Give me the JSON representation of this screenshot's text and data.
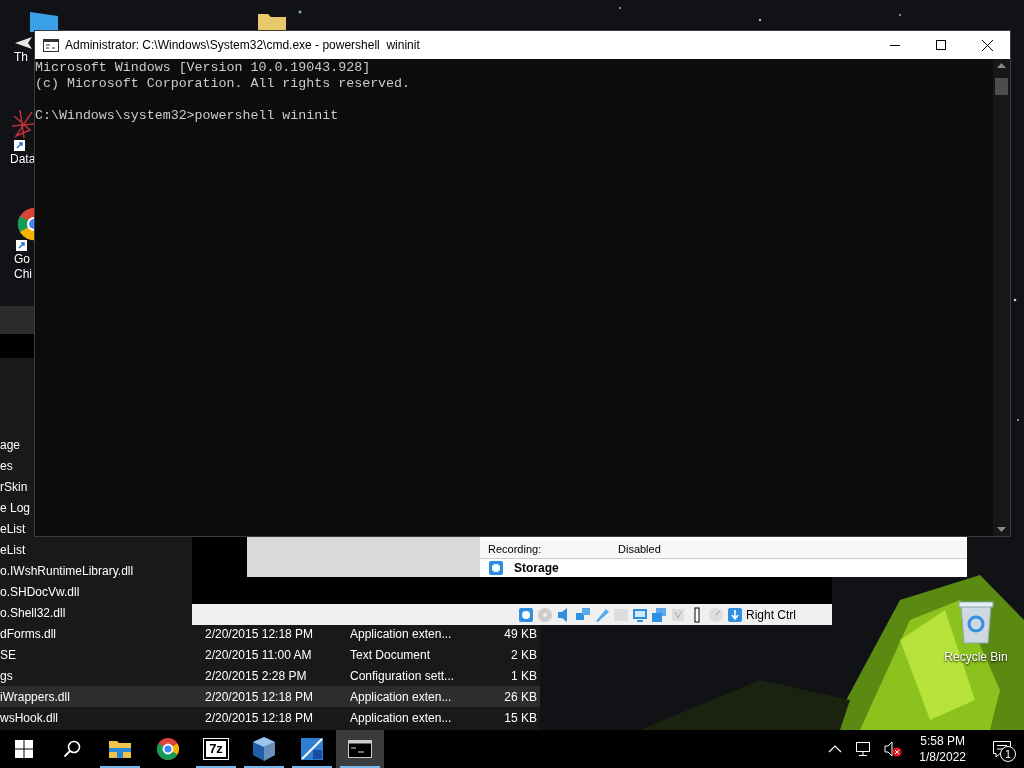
{
  "desktop": {
    "icons": [
      {
        "kind": "blue-window"
      },
      {
        "kind": "folder"
      },
      {
        "kind": "arrow",
        "label_lines": [
          "Th"
        ]
      },
      {
        "kind": "network",
        "label_lines": [
          "Data"
        ]
      },
      {
        "kind": "chrome",
        "label_lines": [
          "Go",
          "Chi"
        ]
      }
    ],
    "recycle_bin": {
      "label": "Recycle Bin"
    }
  },
  "explorer": {
    "rows": [
      {
        "name": "age",
        "selected": false
      },
      {
        "name": "es",
        "selected": false
      },
      {
        "name": "rSkin",
        "selected": false
      },
      {
        "name": "e Log",
        "selected": false
      },
      {
        "name": "eList",
        "selected": false
      },
      {
        "name": "eList",
        "selected": false
      },
      {
        "name": "o.IWshRuntimeLibrary.dll",
        "selected": false
      },
      {
        "name": "o.SHDocVw.dll",
        "selected": false
      },
      {
        "name": "o.Shell32.dll",
        "selected": false
      },
      {
        "name": "dForms.dll",
        "date": "2/20/2015 12:18 PM",
        "type": "Application exten...",
        "size": "49 KB",
        "selected": false
      },
      {
        "name": "SE",
        "date": "2/20/2015 11:00 AM",
        "type": "Text Document",
        "size": "2 KB",
        "selected": false
      },
      {
        "name": "gs",
        "date": "2/20/2015 2:28 PM",
        "type": "Configuration sett...",
        "size": "1 KB",
        "selected": false
      },
      {
        "name": "iWrappers.dll",
        "date": "2/20/2015 12:18 PM",
        "type": "Application exten...",
        "size": "26 KB",
        "selected": true
      },
      {
        "name": "wsHook.dll",
        "date": "2/20/2015 12:18 PM",
        "type": "Application exten...",
        "size": "15 KB",
        "selected": false
      }
    ]
  },
  "virtualbox": {
    "details": [
      {
        "label": "Recording:",
        "value": "Disabled"
      }
    ],
    "section": "Storage",
    "host_key": "Right Ctrl"
  },
  "console": {
    "title": "Administrator: C:\\Windows\\System32\\cmd.exe - powershell  wininit",
    "lines": [
      "Microsoft Windows [Version 10.0.19043.928]",
      "(c) Microsoft Corporation. All rights reserved."
    ],
    "prompt": "C:\\Windows\\system32>powershell wininit"
  },
  "taskbar": {
    "apps": [
      {
        "kind": "start",
        "running": false,
        "active": false
      },
      {
        "kind": "search",
        "running": false,
        "active": false
      },
      {
        "kind": "explorer",
        "running": true,
        "active": false
      },
      {
        "kind": "chrome",
        "running": false,
        "active": false
      },
      {
        "kind": "archiver",
        "badge": "7z",
        "running": true,
        "active": false
      },
      {
        "kind": "virtualbox",
        "running": true,
        "active": false
      },
      {
        "kind": "tiles",
        "running": true,
        "active": false
      },
      {
        "kind": "console",
        "running": true,
        "active": true
      }
    ],
    "volume_muted": true,
    "clock": {
      "time": "5:58 PM",
      "date": "1/8/2022"
    },
    "notification_count": "1"
  }
}
